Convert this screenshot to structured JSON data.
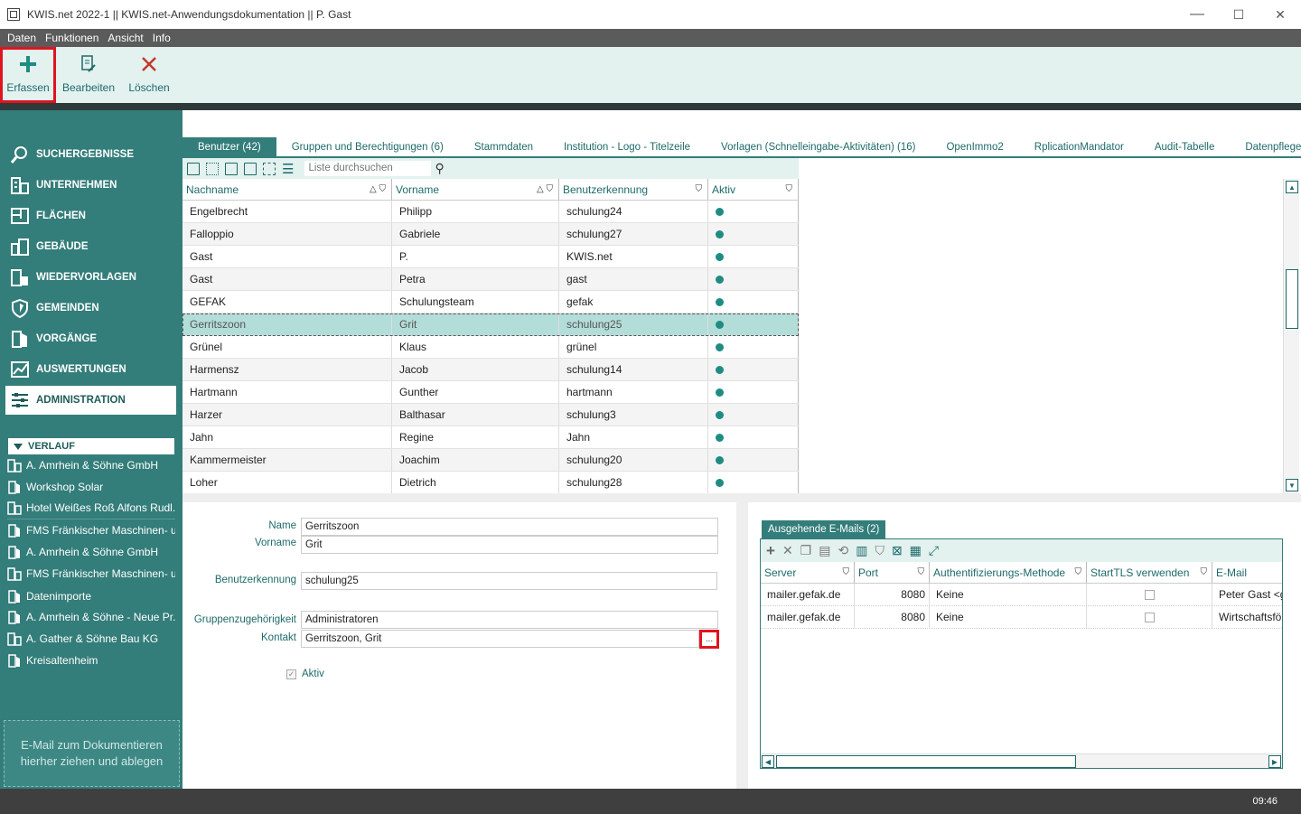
{
  "window": {
    "title": "KWIS.net 2022-1 || KWIS.net-Anwendungsdokumentation || P. Gast",
    "minimize": "—",
    "maximize": "☐",
    "close": "✕"
  },
  "menu": [
    "Daten",
    "Funktionen",
    "Ansicht",
    "Info"
  ],
  "ribbon": {
    "add_label": "Erfassen",
    "edit_label": "Bearbeiten",
    "delete_label": "Löschen",
    "add_color": "#1e8c82",
    "delete_color": "#c0392b"
  },
  "sidebar": {
    "items": [
      {
        "label": "SUCHERGEBNISSE",
        "icon": "search-icon"
      },
      {
        "label": "UNTERNEHMEN",
        "icon": "building-icon"
      },
      {
        "label": "FLÄCHEN",
        "icon": "floorplan-icon"
      },
      {
        "label": "GEBÄUDE",
        "icon": "building-group-icon"
      },
      {
        "label": "WIEDERVORLAGEN",
        "icon": "resubmission-icon"
      },
      {
        "label": "GEMEINDEN",
        "icon": "shield-icon"
      },
      {
        "label": "VORGÄNGE",
        "icon": "process-icon"
      },
      {
        "label": "AUSWERTUNGEN",
        "icon": "chart-icon"
      },
      {
        "label": "ADMINISTRATION",
        "icon": "sliders-icon"
      }
    ],
    "active_index": 8,
    "history_title": "VERLAUF",
    "history": [
      "A. Amrhein & Söhne GmbH",
      "Workshop Solar",
      "Hotel Weißes Roß Alfons Rudl...",
      "FMS Fränkischer Maschinen- u...",
      "A. Amrhein & Söhne GmbH",
      "FMS Fränkischer Maschinen- u...",
      "Datenimporte",
      "A. Amrhein & Söhne - Neue Pr...",
      "A. Gather & Söhne Bau KG",
      "Kreisaltenheim"
    ],
    "dropzone_line1": "E-Mail  zum Dokumentieren",
    "dropzone_line2": "hierher ziehen und ablegen"
  },
  "tabs": [
    "Benutzer (42)",
    "Gruppen und Berechtigungen (6)",
    "Stammdaten",
    "Institution - Logo - Titelzeile",
    "Vorlagen (Schnelleingabe-Aktivitäten) (16)",
    "OpenImmo2",
    "RplicationMandator",
    "Audit-Tabelle",
    "Datenpflege"
  ],
  "search": {
    "placeholder": "Liste durchsuchen"
  },
  "grid": {
    "columns": [
      "Nachname",
      "Vorname",
      "Benutzerkennung",
      "Aktiv"
    ],
    "rows": [
      {
        "nachname": "Engelbrecht",
        "vorname": "Philipp",
        "kennung": "schulung24",
        "aktiv": true
      },
      {
        "nachname": "Falloppio",
        "vorname": "Gabriele",
        "kennung": "schulung27",
        "aktiv": true
      },
      {
        "nachname": "Gast",
        "vorname": "P.",
        "kennung": "KWIS.net",
        "aktiv": true
      },
      {
        "nachname": "Gast",
        "vorname": "Petra",
        "kennung": "gast",
        "aktiv": true
      },
      {
        "nachname": "GEFAK",
        "vorname": "Schulungsteam",
        "kennung": "gefak",
        "aktiv": true
      },
      {
        "nachname": "Gerritszoon",
        "vorname": "Grit",
        "kennung": "schulung25",
        "aktiv": true
      },
      {
        "nachname": "Grünel",
        "vorname": "Klaus",
        "kennung": "grünel",
        "aktiv": true
      },
      {
        "nachname": "Harmensz",
        "vorname": "Jacob",
        "kennung": "schulung14",
        "aktiv": true
      },
      {
        "nachname": "Hartmann",
        "vorname": "Gunther",
        "kennung": "hartmann",
        "aktiv": true
      },
      {
        "nachname": "Harzer",
        "vorname": "Balthasar",
        "kennung": "schulung3",
        "aktiv": true
      },
      {
        "nachname": "Jahn",
        "vorname": "Regine",
        "kennung": "Jahn",
        "aktiv": true
      },
      {
        "nachname": "Kammermeister",
        "vorname": "Joachim",
        "kennung": "schulung20",
        "aktiv": true
      },
      {
        "nachname": "Loher",
        "vorname": "Dietrich",
        "kennung": "schulung28",
        "aktiv": true
      }
    ],
    "selected_index": 5,
    "active_dot_color": "#1e8c82"
  },
  "detail": {
    "name_label": "Name",
    "name_value": "Gerritszoon",
    "vorname_label": "Vorname",
    "vorname_value": "Grit",
    "kennung_label": "Benutzerkennung",
    "kennung_value": "schulung25",
    "gruppe_label": "Gruppenzugehörigkeit",
    "gruppe_value": "Administratoren",
    "kontakt_label": "Kontakt",
    "kontakt_value": "Gerritszoon, Grit",
    "ellipsis": "...",
    "aktiv_label": "Aktiv",
    "aktiv_checked": true
  },
  "mails": {
    "tab_label": "Ausgehende E-Mails (2)",
    "columns": [
      "Server",
      "Port",
      "Authentifizierungs-Methode",
      "StartTLS verwenden",
      "E-Mail"
    ],
    "rows": [
      {
        "server": "mailer.gefak.de",
        "port": "8080",
        "auth": "Keine",
        "starttls": false,
        "email": "Peter Gast <g"
      },
      {
        "server": "mailer.gefak.de",
        "port": "8080",
        "auth": "Keine",
        "starttls": false,
        "email": "Wirtschaftsför"
      }
    ]
  },
  "status": {
    "time": "09:46"
  }
}
